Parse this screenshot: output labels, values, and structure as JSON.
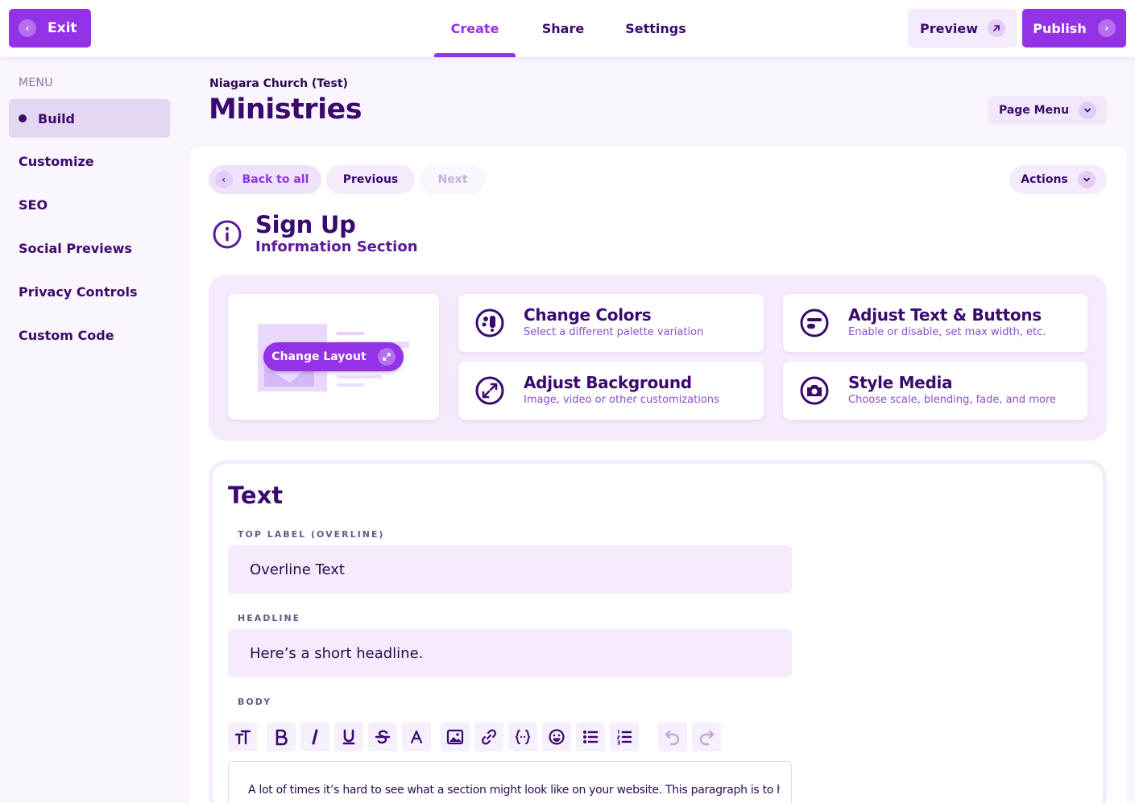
{
  "topbar": {
    "exit_label": "Exit",
    "tabs": [
      {
        "label": "Create",
        "active": true
      },
      {
        "label": "Share",
        "active": false
      },
      {
        "label": "Settings",
        "active": false
      }
    ],
    "preview_label": "Preview",
    "publish_label": "Publish"
  },
  "sidebar": {
    "heading": "MENU",
    "items": [
      {
        "label": "Build",
        "active": true
      },
      {
        "label": "Customize",
        "active": false
      },
      {
        "label": "SEO",
        "active": false
      },
      {
        "label": "Social Previews",
        "active": false
      },
      {
        "label": "Privacy Controls",
        "active": false
      },
      {
        "label": "Custom Code",
        "active": false
      }
    ]
  },
  "page": {
    "org_name": "Niagara Church (Test)",
    "title": "Ministries",
    "page_menu_label": "Page Menu"
  },
  "section_nav": {
    "back_label": "Back to all",
    "previous_label": "Previous",
    "next_label": "Next",
    "actions_label": "Actions"
  },
  "section": {
    "title": "Sign Up",
    "subtitle": "Information Section"
  },
  "options": {
    "change_layout_label": "Change Layout",
    "cards": [
      {
        "title": "Change Colors",
        "desc": "Select a different palette variation",
        "icon": "palette-icon"
      },
      {
        "title": "Adjust Text & Buttons",
        "desc": "Enable or disable, set max width, etc.",
        "icon": "text-button-icon"
      },
      {
        "title": "Adjust Background",
        "desc": "Image, video or other customizations",
        "icon": "expand-icon"
      },
      {
        "title": "Style Media",
        "desc": "Choose scale, blending, fade, and more",
        "icon": "camera-icon"
      }
    ]
  },
  "text_panel": {
    "heading": "Text",
    "overline_label": "TOP LABEL (OVERLINE)",
    "overline_value": "Overline Text",
    "headline_label": "HEADLINE",
    "headline_value": "Here’s a short headline.",
    "body_label": "BODY",
    "body_text": "A lot of times it’s hard to see what a section might look like on your website. This paragraph is to help"
  },
  "toolbar_icons": [
    "text-size-icon",
    "bold-icon",
    "italic-icon",
    "underline-icon",
    "strikethrough-icon",
    "font-color-icon",
    "image-icon",
    "link-icon",
    "variable-icon",
    "emoji-icon",
    "bullet-list-icon",
    "numbered-list-icon",
    "undo-icon",
    "redo-icon"
  ],
  "colors": {
    "accent": "#9332e6",
    "text_primary": "#3b0a6e",
    "panel_bg": "#f5ebfc",
    "page_bg": "#fbf5fd"
  }
}
